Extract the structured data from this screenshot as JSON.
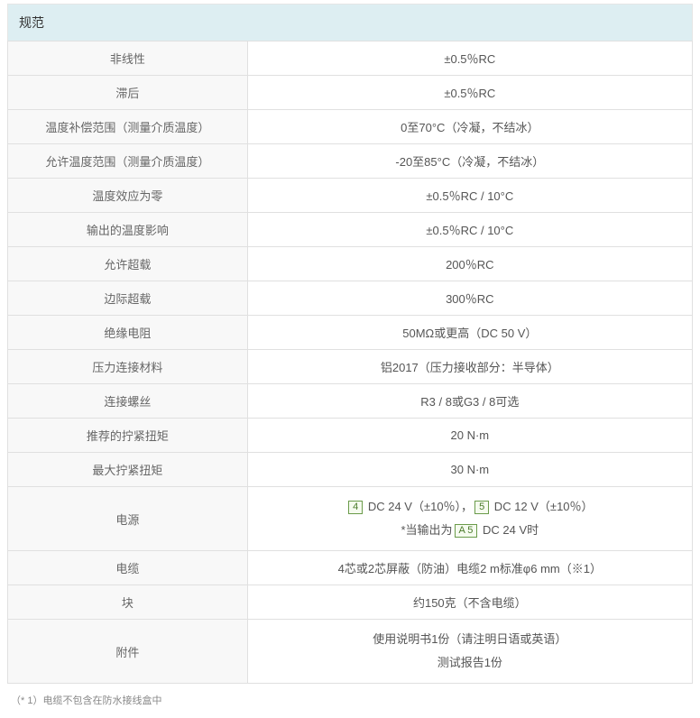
{
  "title": "规范",
  "rows": [
    {
      "label": "非线性",
      "value": "±0.5％RC"
    },
    {
      "label": "滞后",
      "value": "±0.5％RC"
    },
    {
      "label": "温度补偿范围（测量介质温度）",
      "value": "0至70°C（冷凝，不结冰）"
    },
    {
      "label": "允许温度范围（测量介质温度）",
      "value": "-20至85°C（冷凝，不结冰）"
    },
    {
      "label": "温度效应为零",
      "value": "±0.5％RC / 10°C"
    },
    {
      "label": "输出的温度影响",
      "value": "±0.5％RC / 10°C"
    },
    {
      "label": "允许超载",
      "value": "200％RC"
    },
    {
      "label": "边际超载",
      "value": "300％RC"
    },
    {
      "label": "绝缘电阻",
      "value": "50MΩ或更高（DC 50 V）"
    },
    {
      "label": "压力连接材料",
      "value": "铝2017（压力接收部分：半导体）"
    },
    {
      "label": "连接螺丝",
      "value": "R3 / 8或G3 / 8可选"
    },
    {
      "label": "推荐的拧紧扭矩",
      "value": "20 N·m"
    },
    {
      "label": "最大拧紧扭矩",
      "value": "30 N·m"
    }
  ],
  "power": {
    "label": "电源",
    "badge1": "4",
    "seg1": " DC 24 V（±10％），",
    "badge2": "5",
    "seg2": " DC 12 V（±10％）",
    "line2_prefix": "*当输出为",
    "badge3": "A 5",
    "line2_suffix": " DC 24 V时"
  },
  "cable": {
    "label": "电缆",
    "value": "4芯或2芯屏蔽（防油）电缆2 m标准φ6 mm（※1）"
  },
  "block": {
    "label": "块",
    "value": "约150克（不含电缆）"
  },
  "accessory": {
    "label": "附件",
    "line1": "使用说明书1份（请注明日语或英语）",
    "line2": "测试报告1份"
  },
  "footnote": "（* 1）电缆不包含在防水接线盒中"
}
